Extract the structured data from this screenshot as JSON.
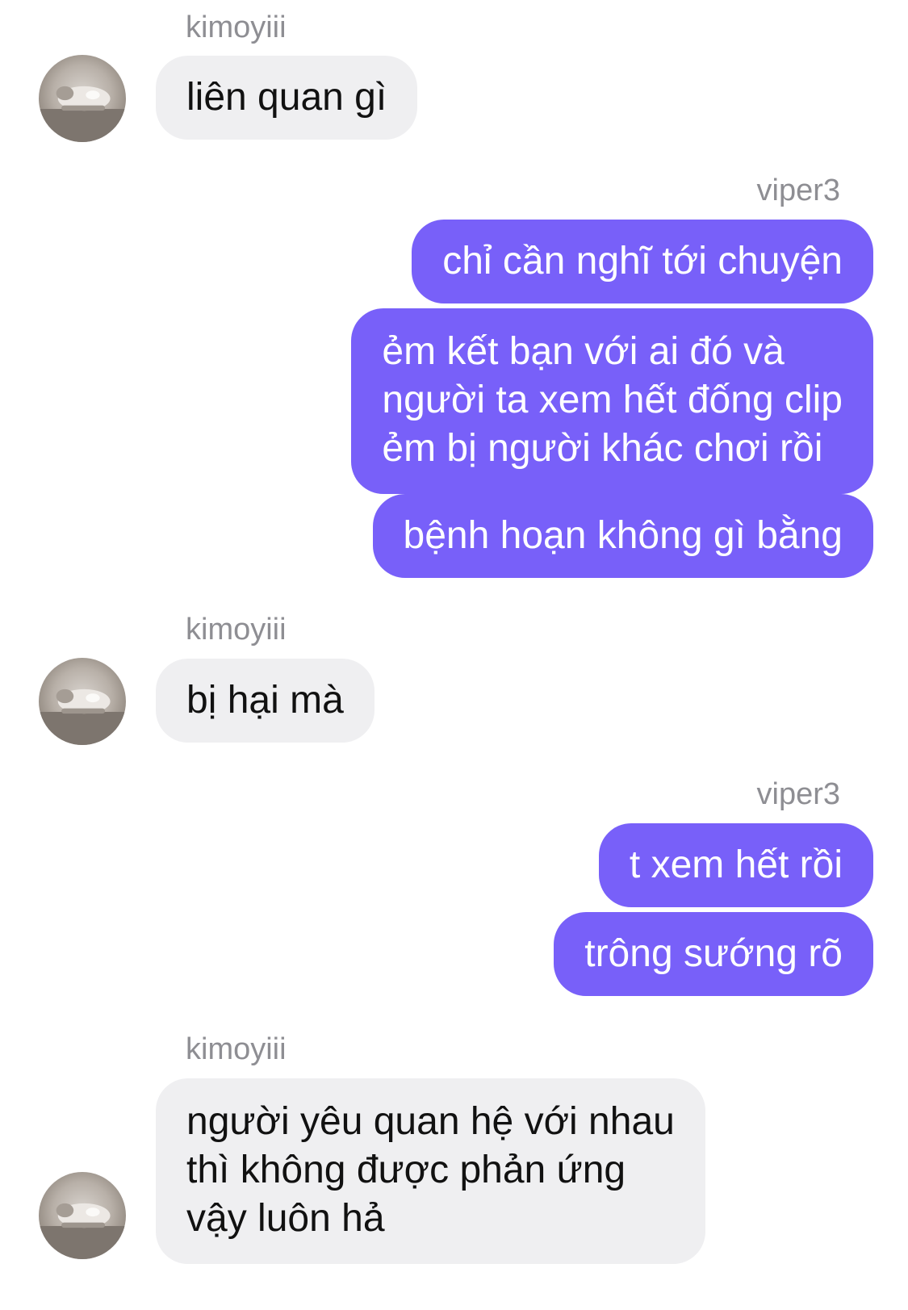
{
  "messages": [
    {
      "sender": "kimoyiii",
      "direction": "incoming",
      "lines": [
        "liên quan gì"
      ]
    },
    {
      "sender": "viper3",
      "direction": "outgoing",
      "lines": [
        "chỉ cần nghĩ tới chuyện"
      ]
    },
    {
      "direction": "outgoing",
      "lines": [
        "ẻm kết bạn với ai đó và",
        "người ta xem hết đống clip",
        "ẻm bị người khác chơi rồi"
      ]
    },
    {
      "direction": "outgoing",
      "lines": [
        "bệnh hoạn không gì bằng"
      ]
    },
    {
      "sender": "kimoyiii",
      "direction": "incoming",
      "lines": [
        "bị hại mà"
      ]
    },
    {
      "sender": "viper3",
      "direction": "outgoing",
      "lines": [
        "t xem hết rồi"
      ]
    },
    {
      "direction": "outgoing",
      "lines": [
        "trông sướng rõ"
      ]
    },
    {
      "sender": "kimoyiii",
      "direction": "incoming",
      "lines": [
        "người yêu quan hệ với nhau",
        "thì không được phản ứng",
        "vậy luôn hả"
      ]
    }
  ],
  "avatar_icon": "cat-photo-avatar",
  "colors": {
    "outgoing_bubble": "#7860f9",
    "incoming_bubble": "#efeff1",
    "sender_name": "#8e8e93"
  }
}
